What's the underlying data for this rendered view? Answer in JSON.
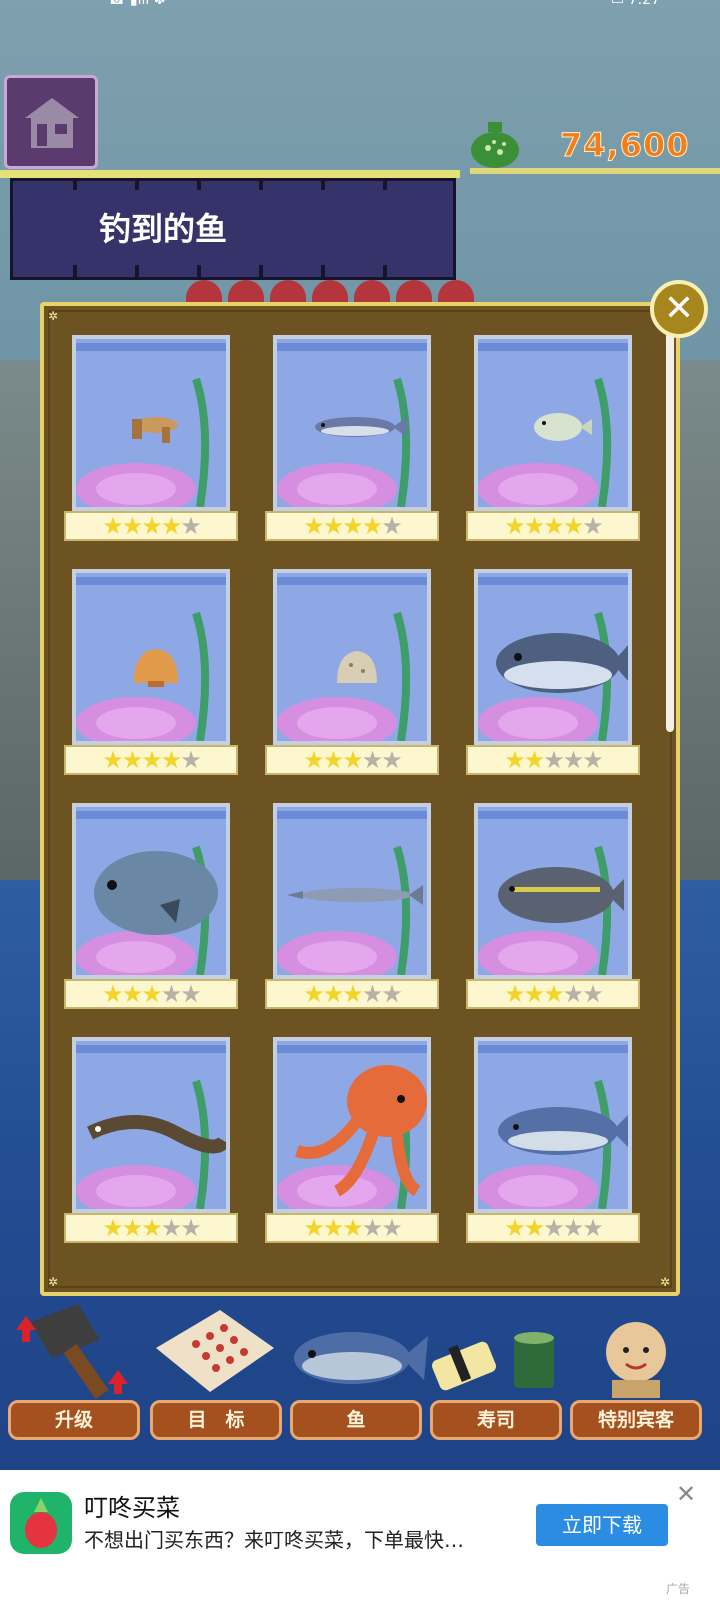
{
  "status": {
    "left": "☎ ▮ill  ✽",
    "time": "▭ 7:27"
  },
  "coins": "74,600",
  "banner_title": "钓到的鱼",
  "tanks": [
    {
      "fish": "mantis-shrimp",
      "stars": 4
    },
    {
      "fish": "sardine",
      "stars": 4
    },
    {
      "fish": "pufferfish",
      "stars": 4
    },
    {
      "fish": "scallop",
      "stars": 4
    },
    {
      "fish": "clam",
      "stars": 3
    },
    {
      "fish": "tuna",
      "stars": 2
    },
    {
      "fish": "sea-bream",
      "stars": 3
    },
    {
      "fish": "saury",
      "stars": 3
    },
    {
      "fish": "yellowtail",
      "stars": 3
    },
    {
      "fish": "eel",
      "stars": 3
    },
    {
      "fish": "octopus",
      "stars": 3
    },
    {
      "fish": "mackerel",
      "stars": 2
    }
  ],
  "nav": [
    {
      "label": "升级",
      "icon": "hammer-icon"
    },
    {
      "label": "目　标",
      "icon": "target-sheet-icon"
    },
    {
      "label": "鱼",
      "icon": "fish-icon"
    },
    {
      "label": "寿司",
      "icon": "sushi-icon"
    },
    {
      "label": "特别宾客",
      "icon": "guest-icon"
    }
  ],
  "ad": {
    "title": "叮咚买菜",
    "desc": "不想出门买东西？来叮咚买菜，下单最快…",
    "button": "立即下载",
    "tag": "广告"
  },
  "colors": {
    "panel": "#6e5322",
    "banner": "#36336a",
    "coins": "#f47c1c",
    "ad_button": "#2a8de3"
  }
}
